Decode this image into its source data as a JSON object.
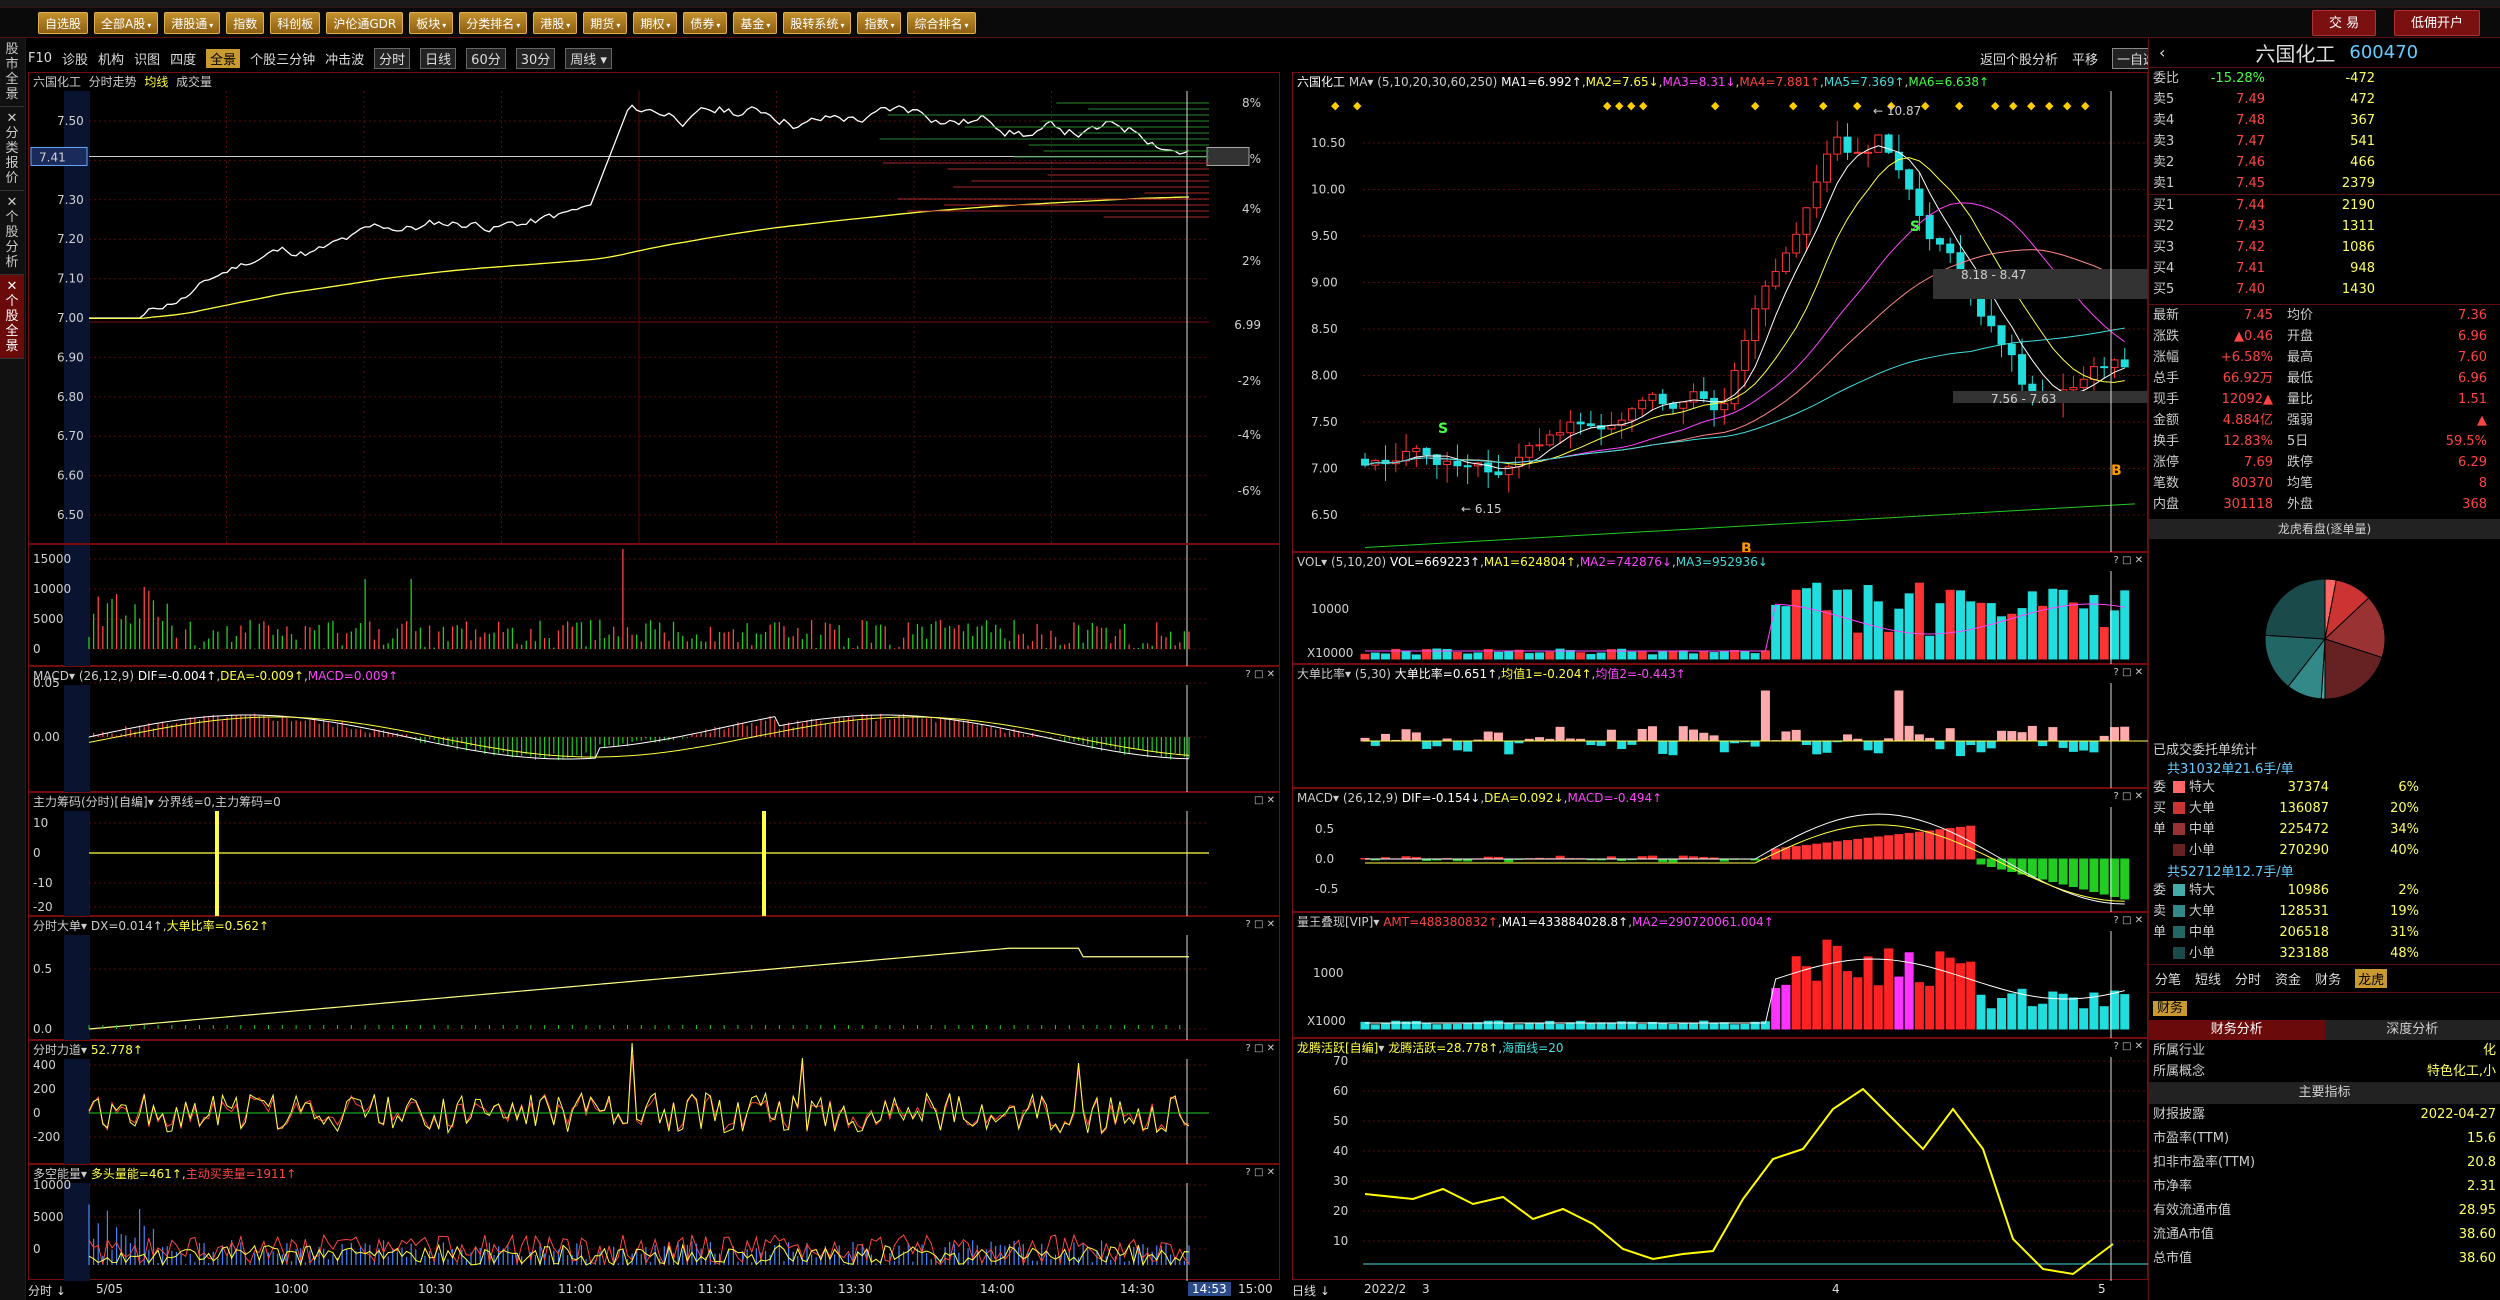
{
  "menu": [
    "自选股",
    "全部A股",
    "港股通",
    "指数",
    "科创板",
    "沪伦通GDR",
    "板块",
    "分类排名",
    "港股",
    "期货",
    "期权",
    "债券",
    "基金",
    "股转系统",
    "指数",
    "综合排名"
  ],
  "menu_dd": [
    false,
    true,
    true,
    false,
    false,
    false,
    true,
    true,
    true,
    true,
    true,
    true,
    true,
    true,
    true,
    true
  ],
  "header_right": {
    "trade": "交 易",
    "open_account": "低佣开户"
  },
  "side_tabs": [
    "股市全景",
    "分类报价",
    "个股分析",
    "个股全景"
  ],
  "left_tabs": [
    "F10",
    "诊股",
    "机构",
    "识图",
    "四度",
    "全景",
    "个股三分钟",
    "冲击波",
    "分时",
    "日线",
    "60分",
    "30分",
    "周线"
  ],
  "right_tabs": {
    "back": "返回个股分析",
    "flat": "平移",
    "select": "一自选"
  },
  "intraday": {
    "title": "六国化工",
    "sub": "分时走势",
    "avg": "均线",
    "vol": "成交量",
    "prices": [
      "7.50",
      "7.40",
      "7.30",
      "7.20",
      "7.10",
      "7.00",
      "6.90",
      "6.80",
      "6.70",
      "6.60",
      "6.50"
    ],
    "pcts": [
      "8%",
      "6.0%",
      "4%",
      "2%",
      "6.99",
      "-2%",
      "-4%",
      "-6%"
    ],
    "current": "7.41",
    "vol_ticks": [
      "15000",
      "10000",
      "5000",
      "0"
    ]
  },
  "times": [
    "5/05",
    "10:00",
    "10:30",
    "11:00",
    "11:30",
    "13:30",
    "14:00",
    "14:30",
    "14:53",
    "15:00"
  ],
  "panels": {
    "macd": {
      "name": "MACD",
      "params": "(26,12,9)",
      "dif": "DIF=-0.004↑",
      "dea": "DEA=-0.009↑",
      "macd": "MACD=0.009↑",
      "ticks": [
        "0.05",
        "0.00"
      ]
    },
    "zl": {
      "name": "主力筹码(分时)",
      "tag": "[自编]",
      "text": "分界线=0,主力筹码=0",
      "ticks": [
        "10",
        "0",
        "-10",
        "-20"
      ]
    },
    "fs": {
      "name": "分时大单",
      "dx": "DX=0.014↑",
      "ratio": "大单比率=0.562↑",
      "ticks": [
        "0.5",
        "0.0"
      ]
    },
    "ld": {
      "name": "分时力道",
      "val": "52.778↑",
      "ticks": [
        "400",
        "200",
        "0",
        "-200"
      ]
    },
    "dk": {
      "name": "多空能量",
      "a": "多头量能=461↑",
      "b": "主动买卖量=1911↑",
      "ticks": [
        "10000",
        "5000",
        "0"
      ]
    }
  },
  "daily": {
    "title": "六国化工",
    "ma_label": "MA",
    "ma": "(5,10,20,30,60,250)",
    "ma1": "MA1=6.992↑",
    "ma2": "MA2=7.65↓",
    "ma3": "MA3=8.31↓",
    "ma4": "MA4=7.881↑",
    "ma5": "MA5=7.369↑",
    "ma6": "MA6=6.638↑",
    "prices": [
      "10.50",
      "10.00",
      "9.50",
      "9.00",
      "8.50",
      "8.00",
      "7.50",
      "7.00",
      "6.50"
    ],
    "hi": "10.87",
    "lo": "6.15",
    "ann1": "8.18 - 8.47",
    "ann2": "7.56 - 7.63",
    "vol": {
      "name": "VOL",
      "params": "(5,10,20)",
      "v": "VOL=669223↑",
      "m1": "MA1=624804↑",
      "m2": "MA2=742876↓",
      "m3": "MA3=952936↓",
      "ticks": [
        "10000",
        "X10000"
      ]
    },
    "dd": {
      "name": "大单比率",
      "params": "(5,30)",
      "a": "大单比率=0.651↑",
      "b": "均值1=-0.204↑",
      "c": "均值2=-0.443↑"
    },
    "macd": {
      "name": "MACD",
      "params": "(26,12,9)",
      "dif": "DIF=-0.154↓",
      "dea": "DEA=0.092↓",
      "macd": "MACD=-0.494↑",
      "ticks": [
        "0.5",
        "0.0",
        "-0.5"
      ]
    },
    "lw": {
      "name": "量王叠现[VIP]",
      "a": "AMT=488380832↑",
      "b": "MA1=433884028.8↑",
      "c": "MA2=290720061.004↑",
      "ticks": [
        "1000",
        "X1000"
      ]
    },
    "lt": {
      "name": "龙腾活跃[自编]",
      "a": "龙腾活跃=28.778↑",
      "b": "海面线=20",
      "ticks": [
        "70",
        "60",
        "50",
        "40",
        "30",
        "20",
        "10"
      ]
    },
    "dates": [
      "2022/2",
      "3",
      "4",
      "5"
    ]
  },
  "quote": {
    "name": "六国化工",
    "code": "600470",
    "webi": "委比",
    "webi_pct": "-15.28%",
    "webi_n": "-472",
    "asks": [
      [
        "卖5",
        "7.49",
        "472"
      ],
      [
        "卖4",
        "7.48",
        "367"
      ],
      [
        "卖3",
        "7.47",
        "541"
      ],
      [
        "卖2",
        "7.46",
        "466"
      ],
      [
        "卖1",
        "7.45",
        "2379"
      ]
    ],
    "bids": [
      [
        "买1",
        "7.44",
        "2190"
      ],
      [
        "买2",
        "7.43",
        "1311"
      ],
      [
        "买3",
        "7.42",
        "1086"
      ],
      [
        "买4",
        "7.41",
        "948"
      ],
      [
        "买5",
        "7.40",
        "1430"
      ]
    ],
    "stats": [
      [
        "最新",
        "7.45",
        "均价",
        "7.36"
      ],
      [
        "涨跌",
        "▲0.46",
        "开盘",
        "6.96"
      ],
      [
        "涨幅",
        "+6.58%",
        "最高",
        "7.60"
      ],
      [
        "总手",
        "66.92万",
        "最低",
        "6.96"
      ],
      [
        "现手",
        "12092▲",
        "量比",
        "1.51"
      ],
      [
        "金额",
        "4.884亿",
        "强弱",
        "▲"
      ],
      [
        "换手",
        "12.83%",
        "5日",
        "59.5%"
      ],
      [
        "涨停",
        "7.69",
        "跌停",
        "6.29"
      ],
      [
        "笔数",
        "80370",
        "均笔",
        "8"
      ],
      [
        "内盘",
        "301118",
        "外盘",
        "368"
      ]
    ],
    "lhb": "龙虎看盘(逐单量)",
    "pending": "已成交委托单统计",
    "buy_total": "共31032单21.6手/单",
    "buy": [
      [
        "特大",
        "37374",
        "6%"
      ],
      [
        "大单",
        "136087",
        "20%"
      ],
      [
        "中单",
        "225472",
        "34%"
      ],
      [
        "小单",
        "270290",
        "40%"
      ]
    ],
    "sell_total": "共52712单12.7手/单",
    "sell": [
      [
        "特大",
        "10986",
        "2%"
      ],
      [
        "大单",
        "128531",
        "19%"
      ],
      [
        "中单",
        "206518",
        "31%"
      ],
      [
        "小单",
        "323188",
        "48%"
      ]
    ],
    "tabs": [
      "分笔",
      "短线",
      "分时",
      "资金",
      "财务",
      "龙虎"
    ],
    "fin": "财务",
    "fin_tabs": [
      "财务分析",
      "深度分析"
    ],
    "fin_rows": [
      [
        "所属行业",
        "化"
      ],
      [
        "所属概念",
        "特色化工,小"
      ]
    ],
    "main_idx": "主要指标",
    "idx_rows": [
      [
        "财报披露",
        "2022-04-27"
      ],
      [
        "市盈率(TTM)",
        "15.6"
      ],
      [
        "扣非市盈率(TTM)",
        "20.8"
      ],
      [
        "市净率",
        "2.31"
      ],
      [
        "有效流通市值",
        "28.95"
      ],
      [
        "流通A市值",
        "38.60"
      ],
      [
        "总市值",
        "38.60"
      ]
    ]
  }
}
